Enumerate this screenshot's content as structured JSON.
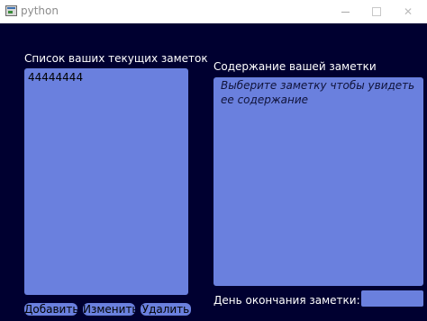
{
  "window": {
    "title": "python",
    "close_glyph": "✕"
  },
  "notes_panel": {
    "label": "Список ваших текущих заметок",
    "items": [
      "44444444"
    ]
  },
  "content_panel": {
    "label": "Содержание вашей заметки",
    "placeholder": "Выберите заметку чтобы увидеть ее содержание"
  },
  "deadline": {
    "label": "День окончания заметки:",
    "value": ""
  },
  "buttons": {
    "add": "Добавить",
    "edit": "Изменить",
    "delete": "Удалить"
  },
  "colors": {
    "background": "#000030",
    "panel": "#6a80de",
    "text": "#ffffff"
  },
  "icons": [
    "app-icon",
    "minimize-icon",
    "maximize-icon",
    "close-icon"
  ]
}
